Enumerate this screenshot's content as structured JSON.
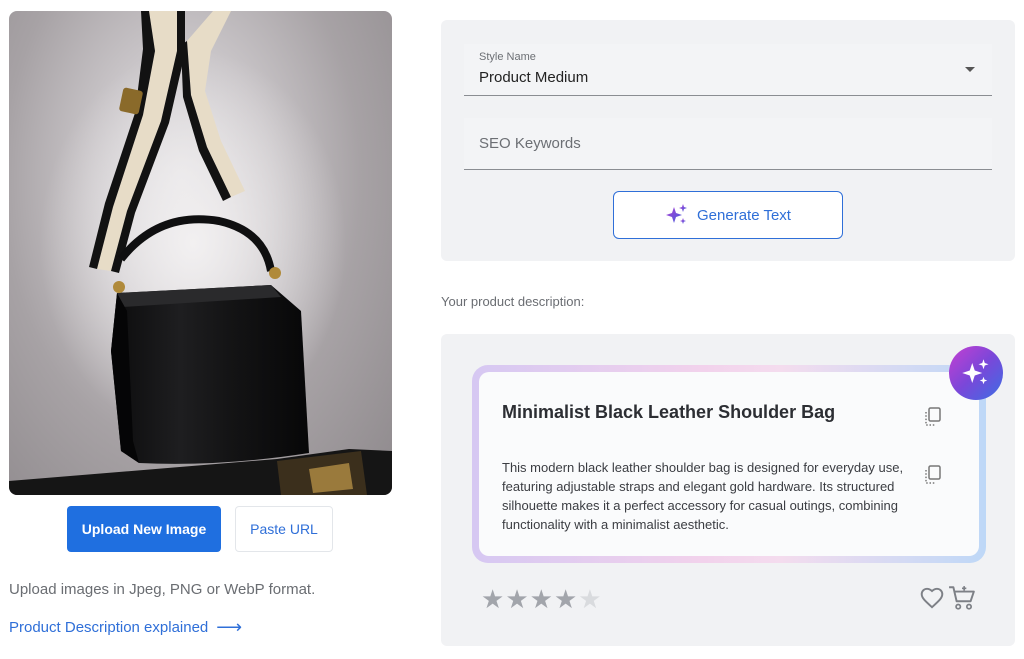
{
  "upload": {
    "upload_button": "Upload New Image",
    "paste_button": "Paste URL",
    "hint": "Upload images in Jpeg, PNG or WebP format.",
    "explained_link": "Product Description explained",
    "explained_arrow": "⟶"
  },
  "form": {
    "style_label": "Style Name",
    "style_value": "Product Medium",
    "seo_placeholder": "SEO Keywords",
    "seo_value": "",
    "generate_button": "Generate Text"
  },
  "result": {
    "section_label": "Your product description:",
    "title": "Minimalist Black Leather Shoulder Bag",
    "description": "This modern black leather shoulder bag is designed for everyday use, featuring adjustable straps and elegant gold hardware. Its structured silhouette makes it a perfect accessory for casual outings, combining functionality with a minimalist aesthetic.",
    "rating": 4,
    "rating_max": 5
  },
  "icons": {
    "generate": "sparkles-icon",
    "badge": "sparkles-icon",
    "copy": "copy-icon",
    "favorite": "heart-icon",
    "cart": "cart-icon",
    "style_caret": "caret-down-icon"
  },
  "colors": {
    "primary": "#1f6fe0",
    "link": "#2f6fd8",
    "card_bg": "#f1f2f4",
    "star_filled": "#a2a5ab",
    "star_empty": "#d9dbde"
  }
}
